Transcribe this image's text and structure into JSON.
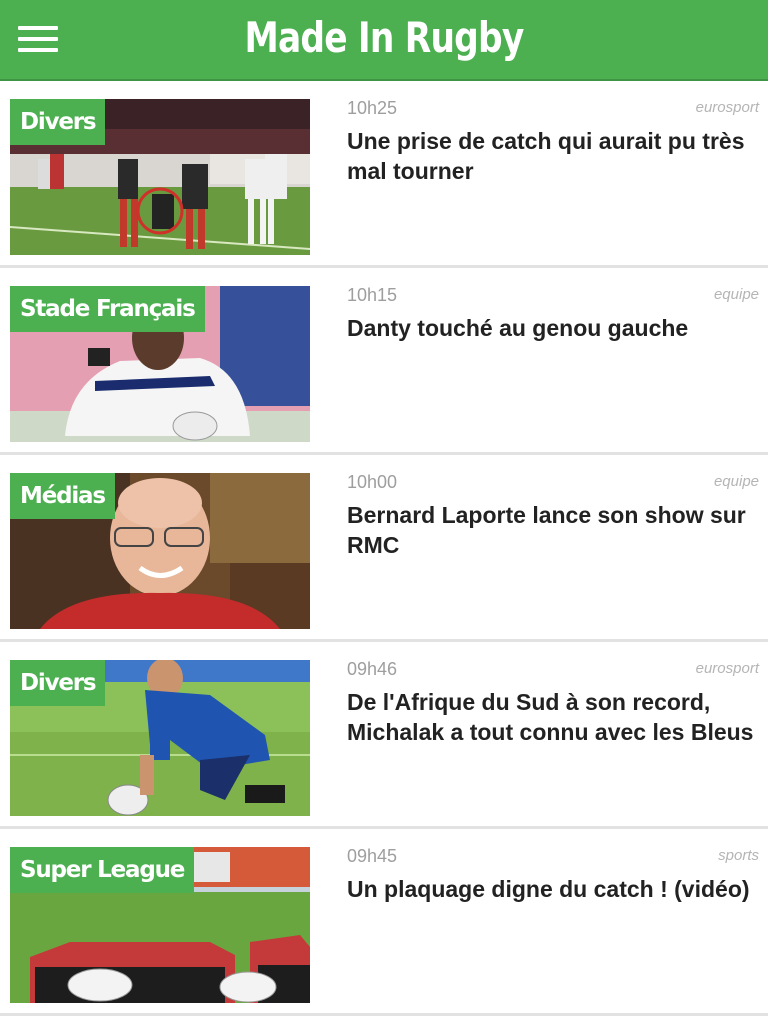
{
  "app": {
    "title": "Made In Rugby"
  },
  "colors": {
    "header": "#4caf50",
    "category_badge": "#4caf50",
    "headline": "#222222",
    "meta": "#9e9e9e"
  },
  "articles": [
    {
      "category": "Divers",
      "time": "10h25",
      "source": "eurosport",
      "title": "Une prise de catch qui aurait pu très mal tourner"
    },
    {
      "category": "Stade Français",
      "time": "10h15",
      "source": "equipe",
      "title": "Danty touché au genou gauche"
    },
    {
      "category": "Médias",
      "time": "10h00",
      "source": "equipe",
      "title": "Bernard Laporte lance son show sur RMC"
    },
    {
      "category": "Divers",
      "time": "09h46",
      "source": "eurosport",
      "title": "De l'Afrique du Sud à son record, Michalak a tout connu avec les Bleus"
    },
    {
      "category": "Super League",
      "time": "09h45",
      "source": "sports",
      "title": "Un plaquage digne du catch ! (vidéo)"
    }
  ]
}
